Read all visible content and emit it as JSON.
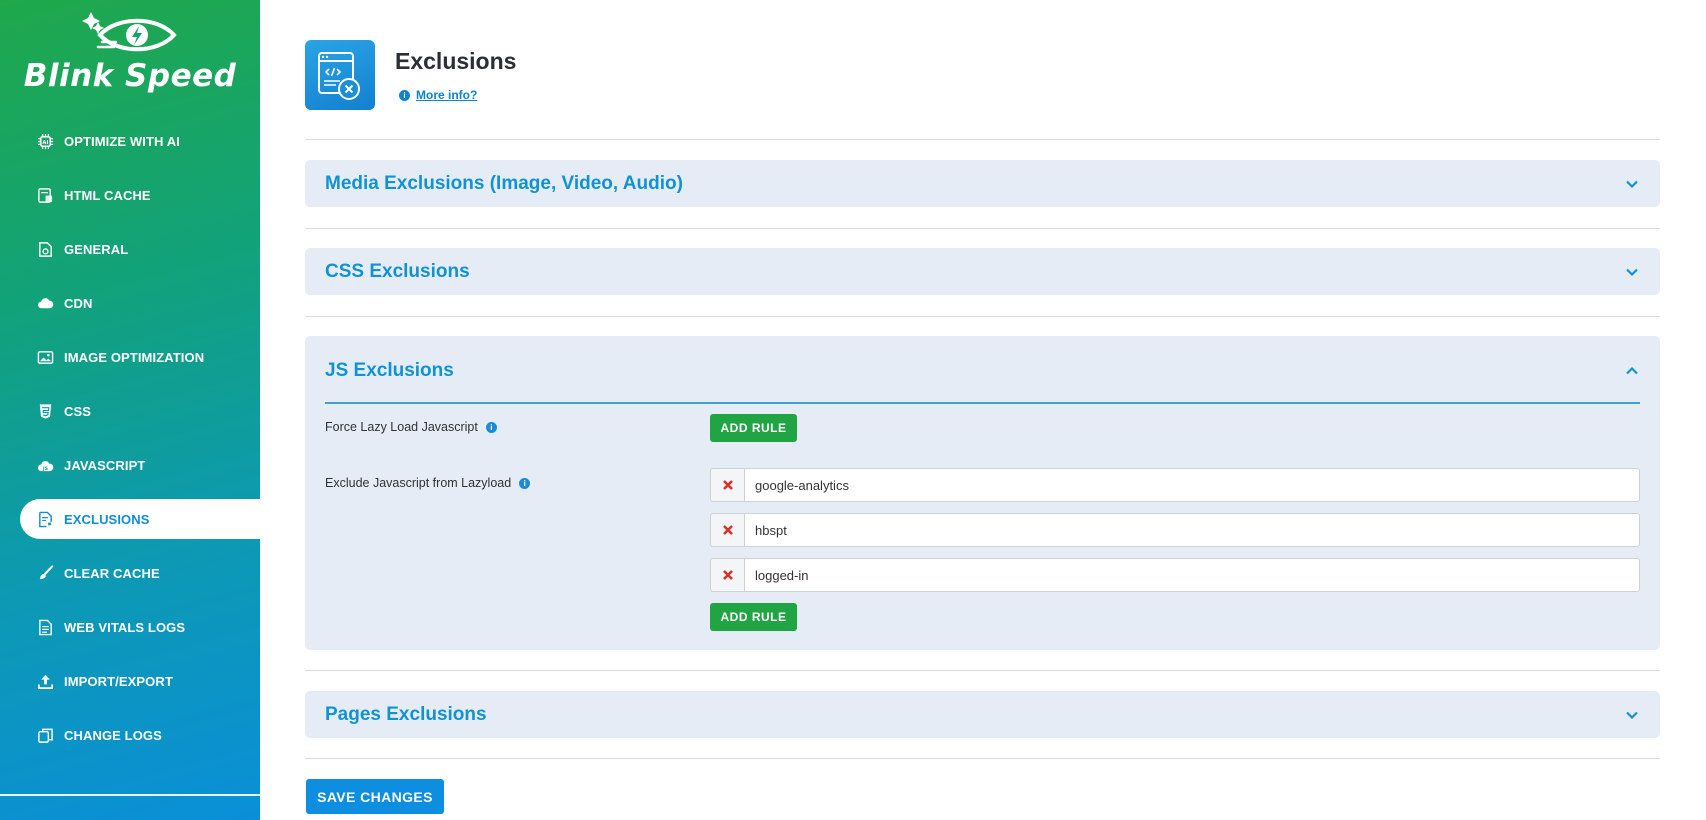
{
  "brand": {
    "name": "Blink Speed",
    "logo_icon": "eye-lightning-logo"
  },
  "sidebar": {
    "items": [
      {
        "label": "OPTIMIZE WITH AI",
        "icon": "ai-chip-icon"
      },
      {
        "label": "HTML CACHE",
        "icon": "html-cache-icon"
      },
      {
        "label": "GENERAL",
        "icon": "settings-doc-icon"
      },
      {
        "label": "CDN",
        "icon": "cloud-icon"
      },
      {
        "label": "IMAGE OPTIMIZATION",
        "icon": "image-icon"
      },
      {
        "label": "CSS",
        "icon": "css3-icon"
      },
      {
        "label": "JAVASCRIPT",
        "icon": "js-cloud-icon"
      },
      {
        "label": "EXCLUSIONS",
        "icon": "exclusions-doc-icon",
        "active": true
      },
      {
        "label": "CLEAR CACHE",
        "icon": "brush-icon"
      },
      {
        "label": "WEB VITALS LOGS",
        "icon": "logs-doc-icon"
      },
      {
        "label": "IMPORT/EXPORT",
        "icon": "upload-icon"
      },
      {
        "label": "CHANGE LOGS",
        "icon": "copy-icon"
      }
    ]
  },
  "header": {
    "title": "Exclusions",
    "more_info": "More info?",
    "icon": "code-window-exclusion-icon"
  },
  "panels": {
    "media": {
      "title": "Media Exclusions (Image, Video, Audio)",
      "expanded": false
    },
    "css": {
      "title": "CSS Exclusions",
      "expanded": false
    },
    "js": {
      "title": "JS Exclusions",
      "expanded": true,
      "force_lazy_label": "Force Lazy Load Javascript",
      "exclude_label": "Exclude Javascript from Lazyload",
      "add_rule_label": "ADD RULE",
      "rules": [
        "google-analytics",
        "hbspt",
        "logged-in"
      ]
    },
    "pages": {
      "title": "Pages Exclusions",
      "expanded": false
    }
  },
  "save_label": "SAVE CHANGES",
  "colors": {
    "accent": "#1193d3",
    "success": "#20a444",
    "panel_bg": "#e6ecf5",
    "remove": "#d9302c"
  }
}
